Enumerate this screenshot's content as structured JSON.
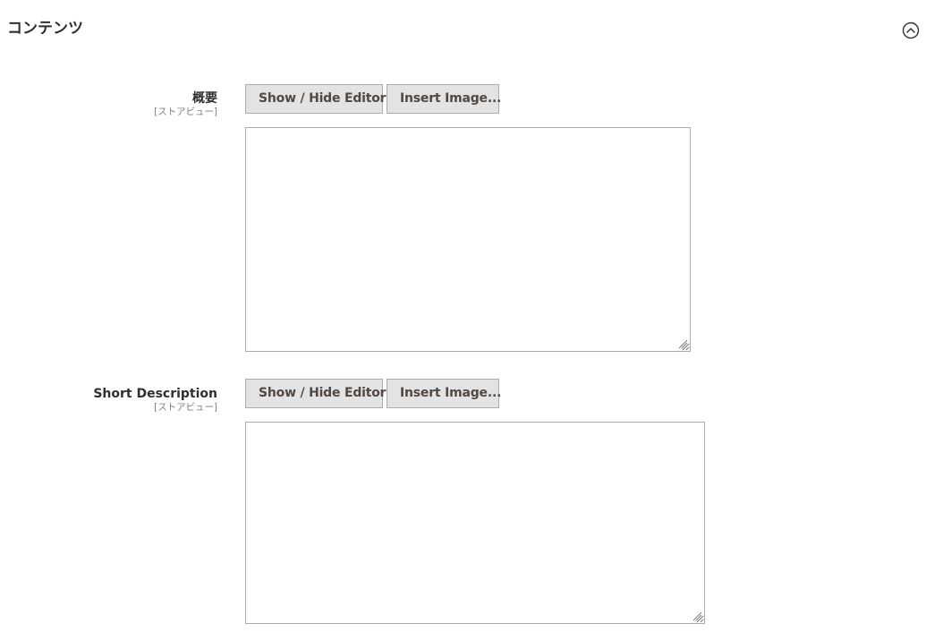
{
  "section": {
    "title": "コンテンツ",
    "toggle_icon": "chevron-up-circle-icon"
  },
  "fields": [
    {
      "label": "概要",
      "scope": "[ストアビュー]",
      "show_hide_label": "Show / Hide Editor",
      "insert_image_label": "Insert Image...",
      "value": ""
    },
    {
      "label": "Short Description",
      "scope": "[ストアビュー]",
      "show_hide_label": "Show / Hide Editor",
      "insert_image_label": "Insert Image...",
      "value": ""
    }
  ],
  "colors": {
    "text": "#303030",
    "scope_text": "#808080",
    "button_bg": "#e3e3e3",
    "button_border": "#adadad",
    "button_text": "#514943",
    "border": "#adadad"
  }
}
